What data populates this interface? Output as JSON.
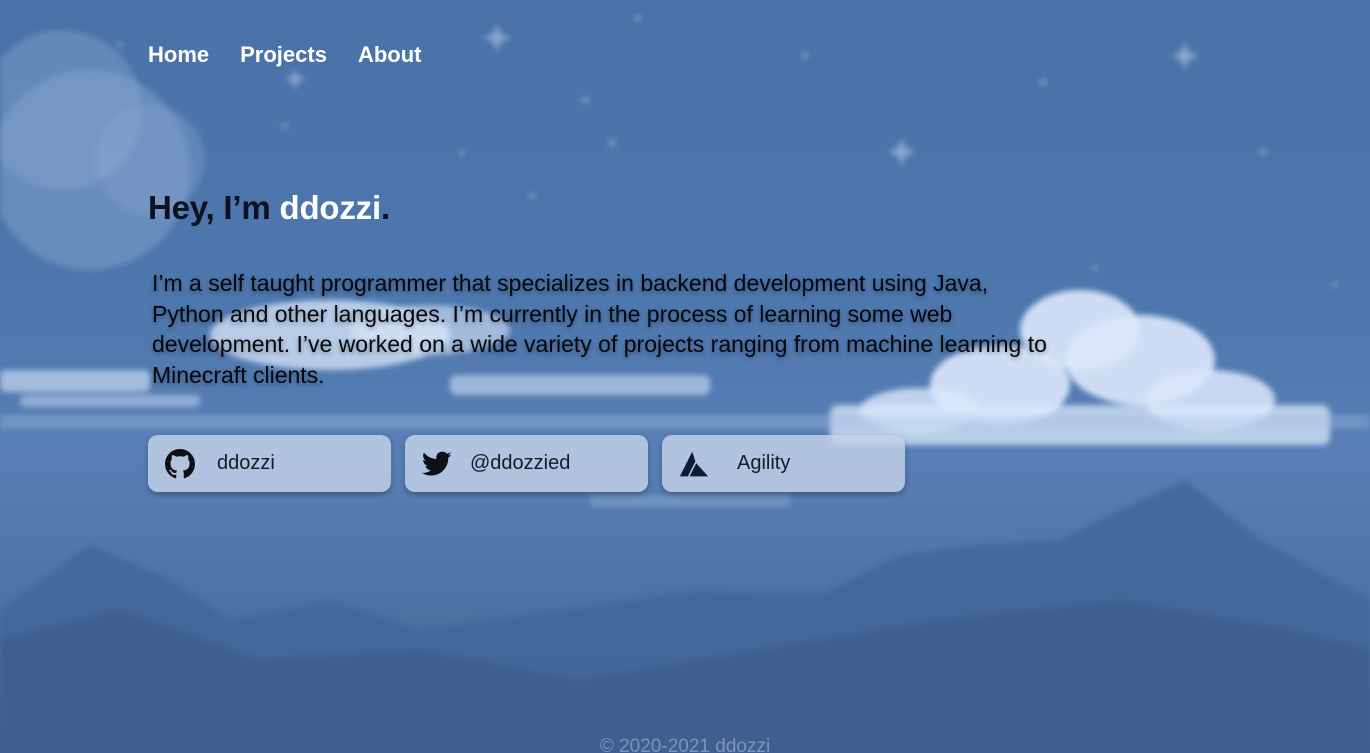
{
  "nav": {
    "items": [
      {
        "label": "Home"
      },
      {
        "label": "Projects"
      },
      {
        "label": "About"
      }
    ]
  },
  "hero": {
    "greeting": "Hey, I’m ",
    "name": "ddozzi",
    "period": ".",
    "bio": "I’m a self taught programmer that specializes in backend development using Java, Python and other languages. I’m currently in the process of learning some web development. I’ve worked on a wide variety of projects ranging from machine learning to Minecraft clients."
  },
  "links": [
    {
      "icon": "github-icon",
      "label": "ddozzi"
    },
    {
      "icon": "twitter-icon",
      "label": "@ddozzied"
    },
    {
      "icon": "agility-icon",
      "label": "Agility"
    }
  ],
  "footer": {
    "text": "© 2020-2021 ddozzi"
  },
  "colors": {
    "sky": "#4a72a8",
    "mountains": "#3f5f8f",
    "clouds": "#dbe8fb",
    "button_bg": "#c4d2e8",
    "title_dark": "#0c1020",
    "title_name": "#ffffff"
  }
}
